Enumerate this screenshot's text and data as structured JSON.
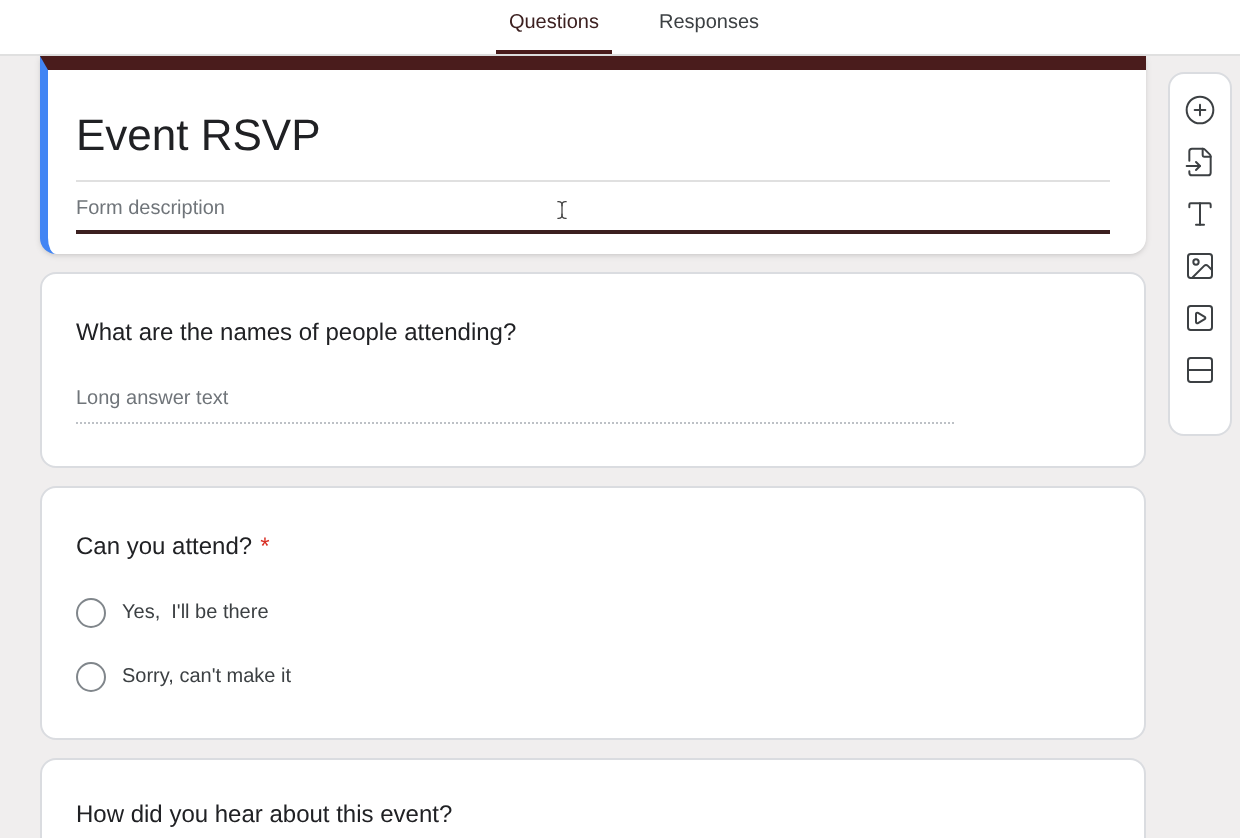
{
  "tabs": [
    {
      "label": "Questions",
      "selected": true
    },
    {
      "label": "Responses",
      "selected": false
    }
  ],
  "form": {
    "title": "Event RSVP",
    "description_placeholder": "Form description"
  },
  "questions": [
    {
      "kind": "paragraph",
      "title": "What are the names of people attending?",
      "placeholder": "Long answer text"
    },
    {
      "kind": "radio",
      "title": "Can you attend?",
      "required": true,
      "required_mark": "*",
      "options": [
        {
          "label": "Yes,  I'll be there",
          "selected": false
        },
        {
          "label": "Sorry, can't make it",
          "selected": false
        }
      ]
    },
    {
      "kind": "cut",
      "title": "How did you hear about this event?"
    }
  ]
}
